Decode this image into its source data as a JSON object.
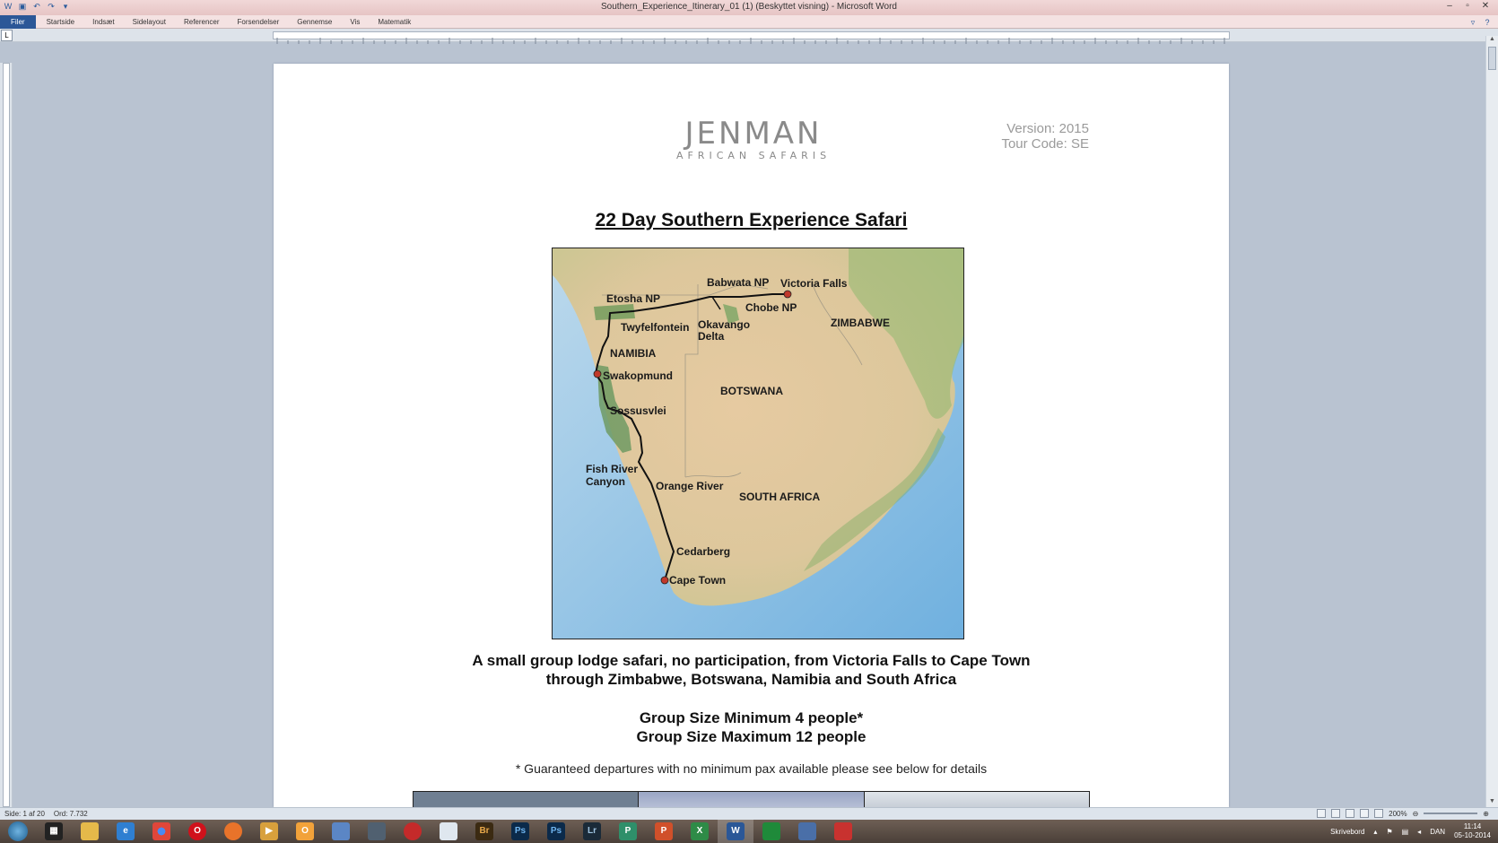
{
  "window": {
    "title": "Southern_Experience_Itinerary_01 (1) (Beskyttet visning) - Microsoft Word",
    "controls": [
      "–",
      "▫",
      "✕"
    ]
  },
  "ribbon": {
    "file_tab": "Filer",
    "tabs": [
      "Startside",
      "Indsæt",
      "Sidelayout",
      "Referencer",
      "Forsendelser",
      "Gennemse",
      "Vis",
      "Matematik"
    ]
  },
  "document": {
    "logo": {
      "brand": "JENMAN",
      "sub": "AFRICAN SAFARIS"
    },
    "version": "Version: 2015",
    "tour_code": "Tour Code: SE",
    "title": "22 Day Southern Experience Safari",
    "map_labels": {
      "babwata": "Babwata NP",
      "victoria": "Victoria Falls",
      "etosha": "Etosha NP",
      "chobe": "Chobe NP",
      "okavango1": "Okavango",
      "okavango2": "Delta",
      "twyfelfontein": "Twyfelfontein",
      "zimbabwe": "ZIMBABWE",
      "namibia": "NAMIBIA",
      "swakopmund": "Swakopmund",
      "botswana": "BOTSWANA",
      "sossusvlei": "Sossusvlei",
      "fishriver1": "Fish River",
      "fishriver2": "Canyon",
      "orange": "Orange River",
      "southafrica": "SOUTH AFRICA",
      "cedarberg": "Cedarberg",
      "capetown": "Cape Town"
    },
    "subtitle_line1": "A small group lodge safari, no participation, from Victoria Falls to Cape Town",
    "subtitle_line2": "through Zimbabwe, Botswana, Namibia and South Africa",
    "group_min": "Group Size Minimum 4 people*",
    "group_max": "Group Size Maximum 12 people",
    "guarantee": "* Guaranteed departures with no minimum pax available please see below for details"
  },
  "statusbar": {
    "page": "Side: 1 af 20",
    "words": "Ord: 7.732",
    "zoom": "200%"
  },
  "taskbar": {
    "desktop_label": "Skrivebord",
    "language": "DAN",
    "time": "11:14",
    "date": "05-10-2014"
  }
}
